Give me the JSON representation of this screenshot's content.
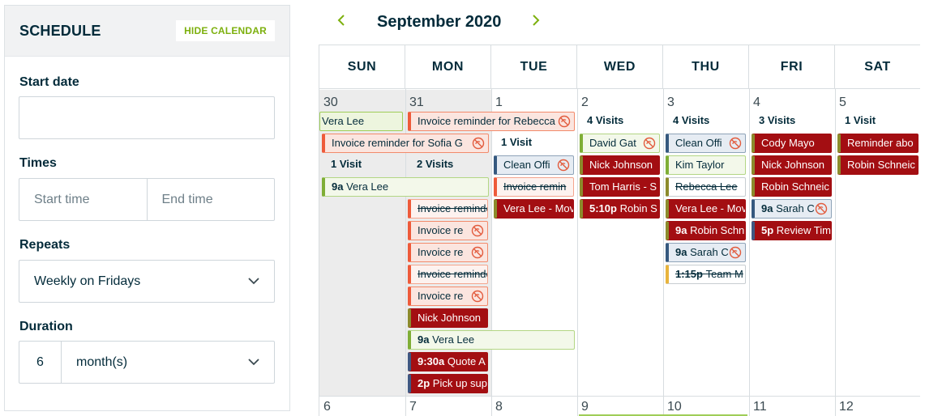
{
  "schedule": {
    "title": "SCHEDULE",
    "hide_calendar_label": "HIDE CALENDAR",
    "start_date_label": "Start date",
    "start_date_value": "",
    "times_label": "Times",
    "start_time_placeholder": "Start time",
    "end_time_placeholder": "End time",
    "repeats_label": "Repeats",
    "repeats_value": "Weekly on Fridays",
    "duration_label": "Duration",
    "duration_number": "6",
    "duration_unit": "month(s)"
  },
  "calendar": {
    "month_title": "September 2020",
    "days_of_week": [
      "SUN",
      "MON",
      "TUE",
      "WED",
      "THU",
      "FRI",
      "SAT"
    ],
    "week1_days": [
      "30",
      "31",
      "1",
      "2",
      "3",
      "4",
      "5"
    ],
    "week2_days": [
      "6",
      "7",
      "8",
      "9",
      "10",
      "11",
      "12"
    ],
    "visit_counts": {
      "sun": "1 Visit",
      "mon": "2 Visits",
      "tue": "1 Visit",
      "wed": "4 Visits",
      "thu": "4 Visits",
      "fri": "3 Visits",
      "sat": "1 Visit"
    },
    "events": {
      "vera_lee_top": "Vera Lee",
      "invoice_rebecca": "Invoice reminder for Rebecca",
      "invoice_sofia": "Invoice reminder for Sofia G",
      "sun_vera_time": "9a",
      "sun_vera_name": "Vera Lee",
      "mon_invoice_1": "Invoice reminder",
      "mon_invoice_2": "Invoice re",
      "mon_invoice_3": "Invoice re",
      "mon_invoice_4": "Invoice reminder",
      "mon_invoice_5": "Invoice re",
      "mon_nick": "Nick Johnson",
      "mon_vera_time": "9a",
      "mon_vera_name": "Vera Lee",
      "mon_quote_time": "9:30a",
      "mon_quote_name": "Quote A",
      "mon_pickup_time": "2p",
      "mon_pickup_name": "Pick up sup",
      "tue_clean": "Clean Offi",
      "tue_invoice": "Invoice remin",
      "tue_vera": "Vera Lee - Mov",
      "wed_david": "David Gat",
      "wed_nick": "Nick Johnson",
      "wed_tom": "Tom Harris - S",
      "wed_robin_time": "5:10p",
      "wed_robin_name": "Robin S",
      "thu_clean": "Clean Offi",
      "thu_kim": "Kim Taylor",
      "thu_rebecca": "Rebecca Lee",
      "thu_vera": "Vera Lee - Mov",
      "thu_robin_time": "9a",
      "thu_robin_name": "Robin Schn",
      "thu_sarah_time": "9a",
      "thu_sarah_name": "Sarah C",
      "thu_team_time": "1:15p",
      "thu_team_name": "Team M",
      "fri_cody": "Cody Mayo",
      "fri_nick": "Nick Johnson",
      "fri_robin": "Robin Schneic",
      "fri_sarah_time": "9a",
      "fri_sarah_name": "Sarah C",
      "fri_review_time": "5p",
      "fri_review_name": "Review Tim",
      "sat_reminder": "Reminder abo",
      "sat_robin": "Robin Schneic"
    }
  },
  "colors": {
    "accent_green": "#7db00e",
    "event_red": "#a30e12",
    "invoice_salmon": "#ee5a3a",
    "text_navy": "#032b3a"
  }
}
